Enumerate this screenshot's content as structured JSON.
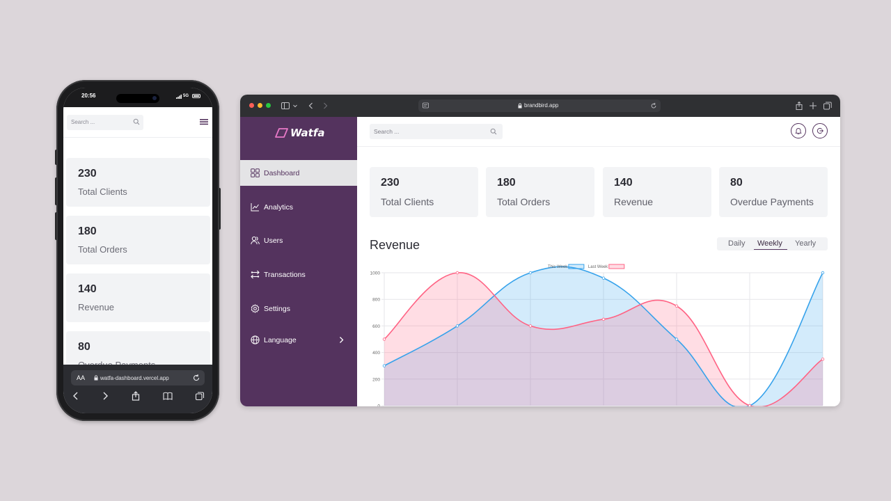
{
  "phone": {
    "status_time": "20:56",
    "status_signal": "5G",
    "search_placeholder": "Search ...",
    "cards": [
      {
        "value": "230",
        "label": "Total Clients"
      },
      {
        "value": "180",
        "label": "Total Orders"
      },
      {
        "value": "140",
        "label": "Revenue"
      },
      {
        "value": "80",
        "label": "Overdue Payments"
      }
    ],
    "url_aa": "AA",
    "url": "watfa-dashboard.vercel.app"
  },
  "browser": {
    "url": "brandbird.app",
    "traffic_colors": [
      "#ff5f57",
      "#febc2e",
      "#28c840"
    ]
  },
  "app": {
    "brand": "Watfa",
    "colors": {
      "sidebar": "#54335e",
      "this_week": "#36a2eb",
      "last_week": "#ff6384",
      "accent_logo": "#e879c8"
    },
    "search_placeholder": "Search ...",
    "nav": [
      {
        "label": "Dashboard",
        "icon": "grid-icon",
        "active": true
      },
      {
        "label": "Analytics",
        "icon": "line-chart-icon"
      },
      {
        "label": "Users",
        "icon": "users-icon"
      },
      {
        "label": "Transactions",
        "icon": "transactions-icon"
      },
      {
        "label": "Settings",
        "icon": "gear-icon"
      },
      {
        "label": "Language",
        "icon": "globe-icon",
        "has_submenu": true
      }
    ],
    "header_buttons": [
      "bell-icon",
      "logout-icon"
    ],
    "stats": [
      {
        "value": "230",
        "label": "Total Clients"
      },
      {
        "value": "180",
        "label": "Total Orders"
      },
      {
        "value": "140",
        "label": "Revenue"
      },
      {
        "value": "80",
        "label": "Overdue Payments"
      }
    ],
    "revenue_title": "Revenue",
    "tabs": [
      {
        "label": "Daily"
      },
      {
        "label": "Weekly",
        "active": true
      },
      {
        "label": "Yearly"
      }
    ]
  },
  "chart_data": {
    "type": "area",
    "yticks": [
      "0",
      "200",
      "400",
      "600",
      "800",
      "1000"
    ],
    "ylim": [
      0,
      1000
    ],
    "grid": true,
    "legend_position": "top",
    "series": [
      {
        "name": "This Week",
        "color": "#36a2eb",
        "values": [
          300,
          600,
          1000,
          960,
          500,
          0,
          1000
        ]
      },
      {
        "name": "Last Week",
        "color": "#ff6384",
        "values": [
          500,
          1000,
          600,
          650,
          750,
          0,
          350
        ]
      }
    ]
  }
}
